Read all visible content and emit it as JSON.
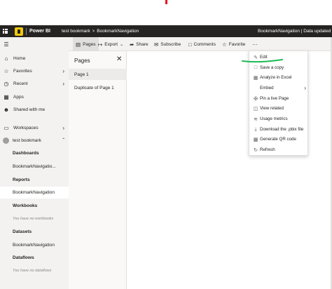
{
  "header": {
    "app_name": "Power BI",
    "workspace": "test bookmark",
    "chevron": ">",
    "report": "BookmarkNavigation",
    "title_right": "BookmarkNavigation  |  Data updated"
  },
  "toolbar": {
    "pages": "Pages",
    "export": "Export",
    "share": "Share",
    "subscribe": "Subscribe",
    "comments": "Comments",
    "favorite": "Favorite",
    "more": "···"
  },
  "nav": {
    "home": "Home",
    "favorites": "Favorites",
    "recent": "Recent",
    "apps": "Apps",
    "shared": "Shared with me",
    "workspaces": "Workspaces",
    "workspace_current": "test bookmark",
    "dashboards_header": "Dashboards",
    "dashboard_item": "BookmarkNavigatio...",
    "reports_header": "Reports",
    "report_item": "BookmarkNavigation",
    "workbooks_header": "Workbooks",
    "no_workbooks": "You have no workbooks",
    "datasets_header": "Datasets",
    "dataset_item": "BookmarkNavigation",
    "dataflows_header": "Dataflows",
    "no_dataflows": "You have no dataflows"
  },
  "pages_pane": {
    "title": "Pages",
    "pages": [
      "Page 1",
      "Duplicate of Page 1"
    ]
  },
  "menu": {
    "edit": "Edit",
    "save_copy": "Save a copy",
    "analyze_excel": "Analyze in Excel",
    "embed": "Embed",
    "pin_live": "Pin a live Page",
    "view_related": "View related",
    "usage_metrics": "Usage metrics",
    "download_pbix": "Download the .pbix file",
    "generate_qr": "Generate QR code",
    "refresh": "Refresh"
  },
  "colors": {
    "topbar": "#252423",
    "accent_yellow": "#f2c811",
    "annotation_green": "#1db954",
    "annotation_red": "#e81123"
  }
}
